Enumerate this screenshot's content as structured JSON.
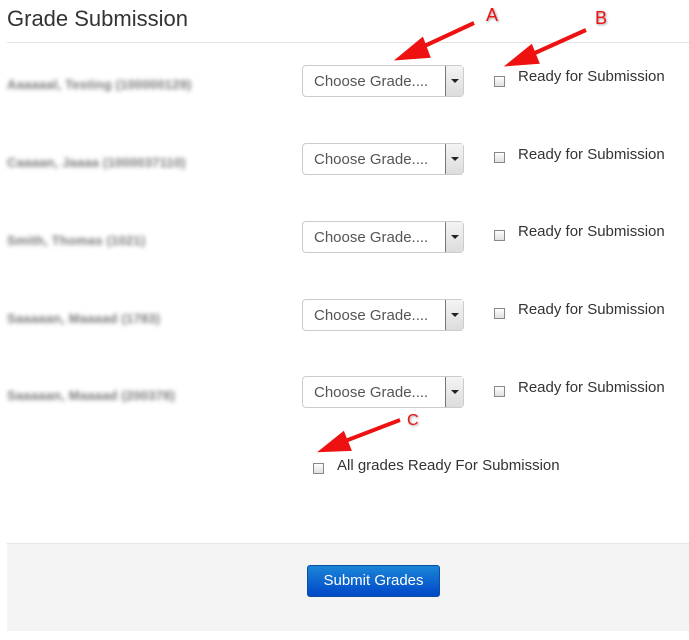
{
  "page": {
    "title": "Grade Submission"
  },
  "students": [
    {
      "name": "Aaaaaal, Testing (100000129)",
      "grade_placeholder": "Choose Grade....",
      "ready_label": "Ready for Submission",
      "ready_checked": false
    },
    {
      "name": "Caaaan, Jaaaa (1000037110)",
      "grade_placeholder": "Choose Grade....",
      "ready_label": "Ready for Submission",
      "ready_checked": false
    },
    {
      "name": "Smith, Thomas (1021)",
      "grade_placeholder": "Choose Grade....",
      "ready_label": "Ready for Submission",
      "ready_checked": false
    },
    {
      "name": "Saaaaan, Maaaad (1783)",
      "grade_placeholder": "Choose Grade....",
      "ready_label": "Ready for Submission",
      "ready_checked": false
    },
    {
      "name": "Saaaaan, Maaaad (200378)",
      "grade_placeholder": "Choose Grade....",
      "ready_label": "Ready for Submission",
      "ready_checked": false
    }
  ],
  "all_ready": {
    "label": "All grades Ready For Submission",
    "checked": false
  },
  "footer": {
    "submit_label": "Submit Grades"
  },
  "annotations": {
    "a": "A",
    "b": "B",
    "c": "C",
    "color": "#ee1111"
  }
}
